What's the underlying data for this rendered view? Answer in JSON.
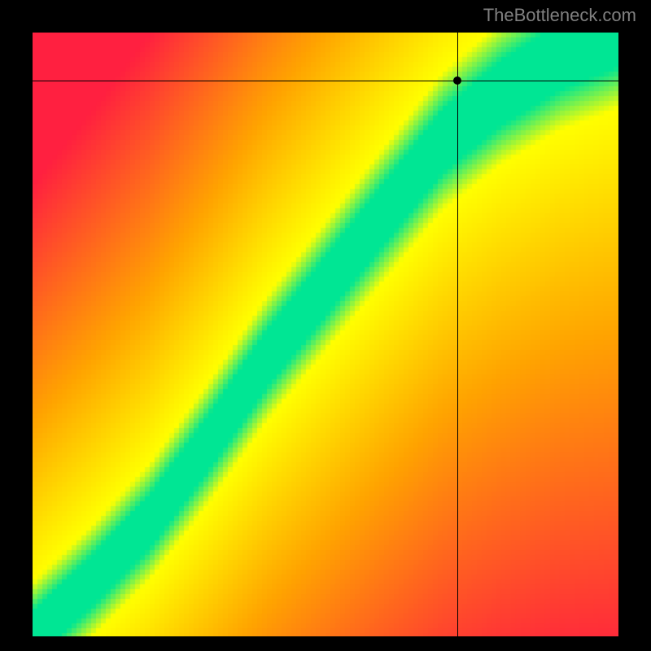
{
  "watermark": "TheBottleneck.com",
  "chart_data": {
    "type": "heatmap",
    "title": "",
    "xlabel": "",
    "ylabel": "",
    "xlim": [
      0,
      100
    ],
    "ylim": [
      0,
      100
    ],
    "crosshair": {
      "x": 72.5,
      "y": 92
    },
    "marker": {
      "x": 72.5,
      "y": 92
    },
    "optimal_curve": [
      {
        "x": 0,
        "y": 0
      },
      {
        "x": 10,
        "y": 9
      },
      {
        "x": 20,
        "y": 19
      },
      {
        "x": 30,
        "y": 32
      },
      {
        "x": 40,
        "y": 46
      },
      {
        "x": 50,
        "y": 58
      },
      {
        "x": 60,
        "y": 70
      },
      {
        "x": 70,
        "y": 82
      },
      {
        "x": 80,
        "y": 90
      },
      {
        "x": 90,
        "y": 96
      },
      {
        "x": 100,
        "y": 100
      }
    ],
    "colors": {
      "optimal": "#00E694",
      "near": "#FFFF00",
      "mid": "#FFA500",
      "far": "#FF2040"
    },
    "grid": false,
    "legend": false
  }
}
